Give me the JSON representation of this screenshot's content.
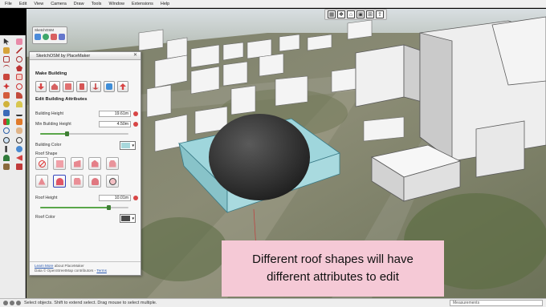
{
  "menubar": {
    "items": [
      "File",
      "Edit",
      "View",
      "Camera",
      "Draw",
      "Tools",
      "Window",
      "Extensions",
      "Help"
    ]
  },
  "top_toolbar": {
    "icons": [
      "layout-icon",
      "components-icon",
      "home-icon",
      "warehouse-icon",
      "extension-icon",
      "upload-icon"
    ]
  },
  "left_toolbar": {
    "icons": [
      "select-icon",
      "eraser-icon",
      "paint-icon",
      "line-icon",
      "rect-icon",
      "circle-icon",
      "arc-icon",
      "polygon-icon",
      "push-pull-icon",
      "offset-icon",
      "move-icon",
      "rotate-icon",
      "scale-icon",
      "follow-me-icon",
      "tape-icon",
      "protractor-icon",
      "text-icon",
      "dimension-icon",
      "axes-icon",
      "section-icon",
      "orbit-icon",
      "pan-icon",
      "zoom-icon",
      "zoom-extents-icon",
      "walk-icon",
      "look-around-icon",
      "position-camera-icon",
      "prev-view-icon",
      "sandbox-icon",
      "stamp-icon"
    ]
  },
  "mini_toolbar": {
    "title": "SketchOSM"
  },
  "panel": {
    "title": "SketchOSM by PlaceMaker",
    "section_make": "Make Building",
    "section_edit": "Edit Building Attributes",
    "building_height_label": "Building Height",
    "building_height_value": "19.61m",
    "min_height_label": "Min Building Height",
    "min_height_value": "4.50m",
    "min_height_slider": 0.3,
    "building_color_label": "Building Color",
    "building_color": "#a8d8dc",
    "roof_shape_label": "Roof Shape",
    "roof_height_label": "Roof Height",
    "roof_height_value": "10.01m",
    "roof_height_slider": 0.78,
    "roof_color_label": "Roof Color",
    "roof_color": "#4a4a4a",
    "footer_line1_link": "Learn More",
    "footer_line1_rest": " about PlaceMaker",
    "footer_line2": "Data © OpenStreetMap contributors - ",
    "footer_terms": "Terms"
  },
  "status": {
    "text": "Select objects. Shift to extend select. Drag mouse to select multiple.",
    "measurements_label": "Measurements"
  },
  "caption": {
    "line1": "Different roof shapes will have",
    "line2": "different attributes to edit"
  }
}
